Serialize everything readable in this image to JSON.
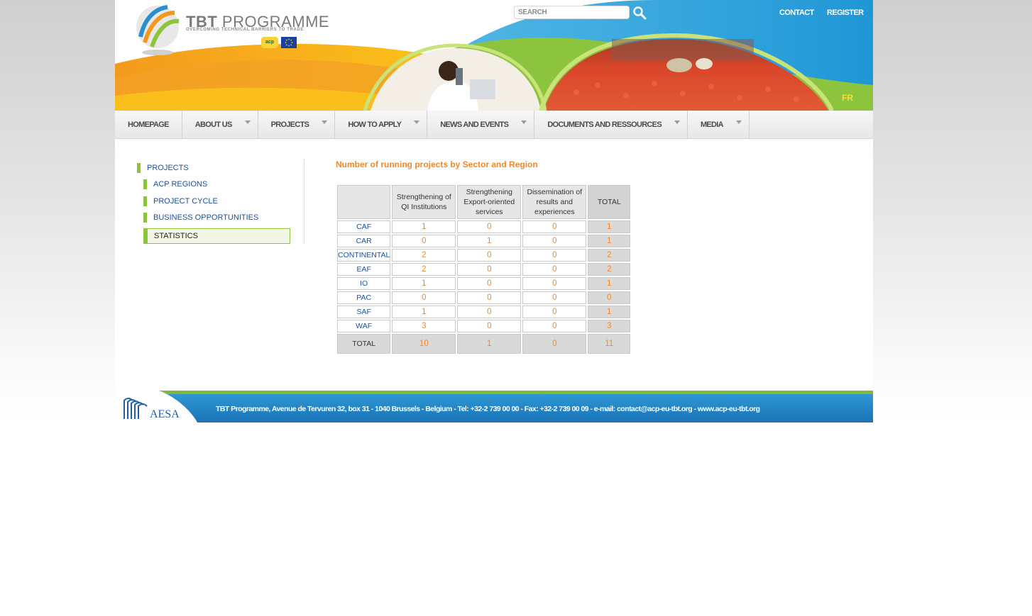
{
  "header": {
    "logo_title_bold": "TBT",
    "logo_title_rest": "PROGRAMME",
    "logo_subtitle": "OVERCOMING TECHNICAL BARRIERS TO TRADE",
    "acp_badge": "acp",
    "search_placeholder": "SEARCH",
    "contact_link": "CONTACT",
    "register_link": "REGISTER",
    "lang_link": "FR"
  },
  "nav": {
    "items": [
      {
        "label": "HOMEPAGE",
        "has_caret": false
      },
      {
        "label": "ABOUT US",
        "has_caret": true
      },
      {
        "label": "PROJECTS",
        "has_caret": true
      },
      {
        "label": "HOW TO APPLY",
        "has_caret": true
      },
      {
        "label": "NEWS AND EVENTS",
        "has_caret": true
      },
      {
        "label": "DOCUMENTS AND RESSOURCES",
        "has_caret": true
      },
      {
        "label": "MEDIA",
        "has_caret": true
      }
    ]
  },
  "sidebar": {
    "items": [
      {
        "label": "PROJECTS"
      },
      {
        "label": "ACP REGIONS"
      },
      {
        "label": "PROJECT CYCLE"
      },
      {
        "label": "BUSINESS OPPORTUNITIES"
      },
      {
        "label": "STATISTICS",
        "active": true
      }
    ]
  },
  "main": {
    "title": "Number of running projects by Sector and Region",
    "table": {
      "headers": [
        "",
        "Strengthening of QI Institutions",
        "Strengthening Export-oriented services",
        "Dissemination of results and experiences",
        "TOTAL"
      ],
      "rows": [
        [
          "CAF",
          "1",
          "0",
          "0",
          "1"
        ],
        [
          "CAR",
          "0",
          "1",
          "0",
          "1"
        ],
        [
          "CONTINENTAL",
          "2",
          "0",
          "0",
          "2"
        ],
        [
          "EAF",
          "2",
          "0",
          "0",
          "2"
        ],
        [
          "IO",
          "1",
          "0",
          "0",
          "1"
        ],
        [
          "PAC",
          "0",
          "0",
          "0",
          "0"
        ],
        [
          "SAF",
          "1",
          "0",
          "0",
          "1"
        ],
        [
          "WAF",
          "3",
          "0",
          "0",
          "3"
        ]
      ],
      "total_row": [
        "TOTAL",
        "10",
        "1",
        "0",
        "11"
      ]
    }
  },
  "footer": {
    "logo_text": "AESA",
    "address": "TBT Programme, Avenue de Tervuren 32, box 31 - 1040 Brussels - Belgium - Tel: +32-2 739 00 00 - Fax: +32-2 739 00 09 - e-mail: contact@acp-eu-tbt.org - www.acp-eu-tbt.org"
  },
  "colors": {
    "accent_orange": "#f0882c",
    "link_blue": "#1f4f9b",
    "sidebar_green": "#8cc43e",
    "header_blue": "#2aa0dc",
    "footer_blue": "#1e7fc0"
  }
}
